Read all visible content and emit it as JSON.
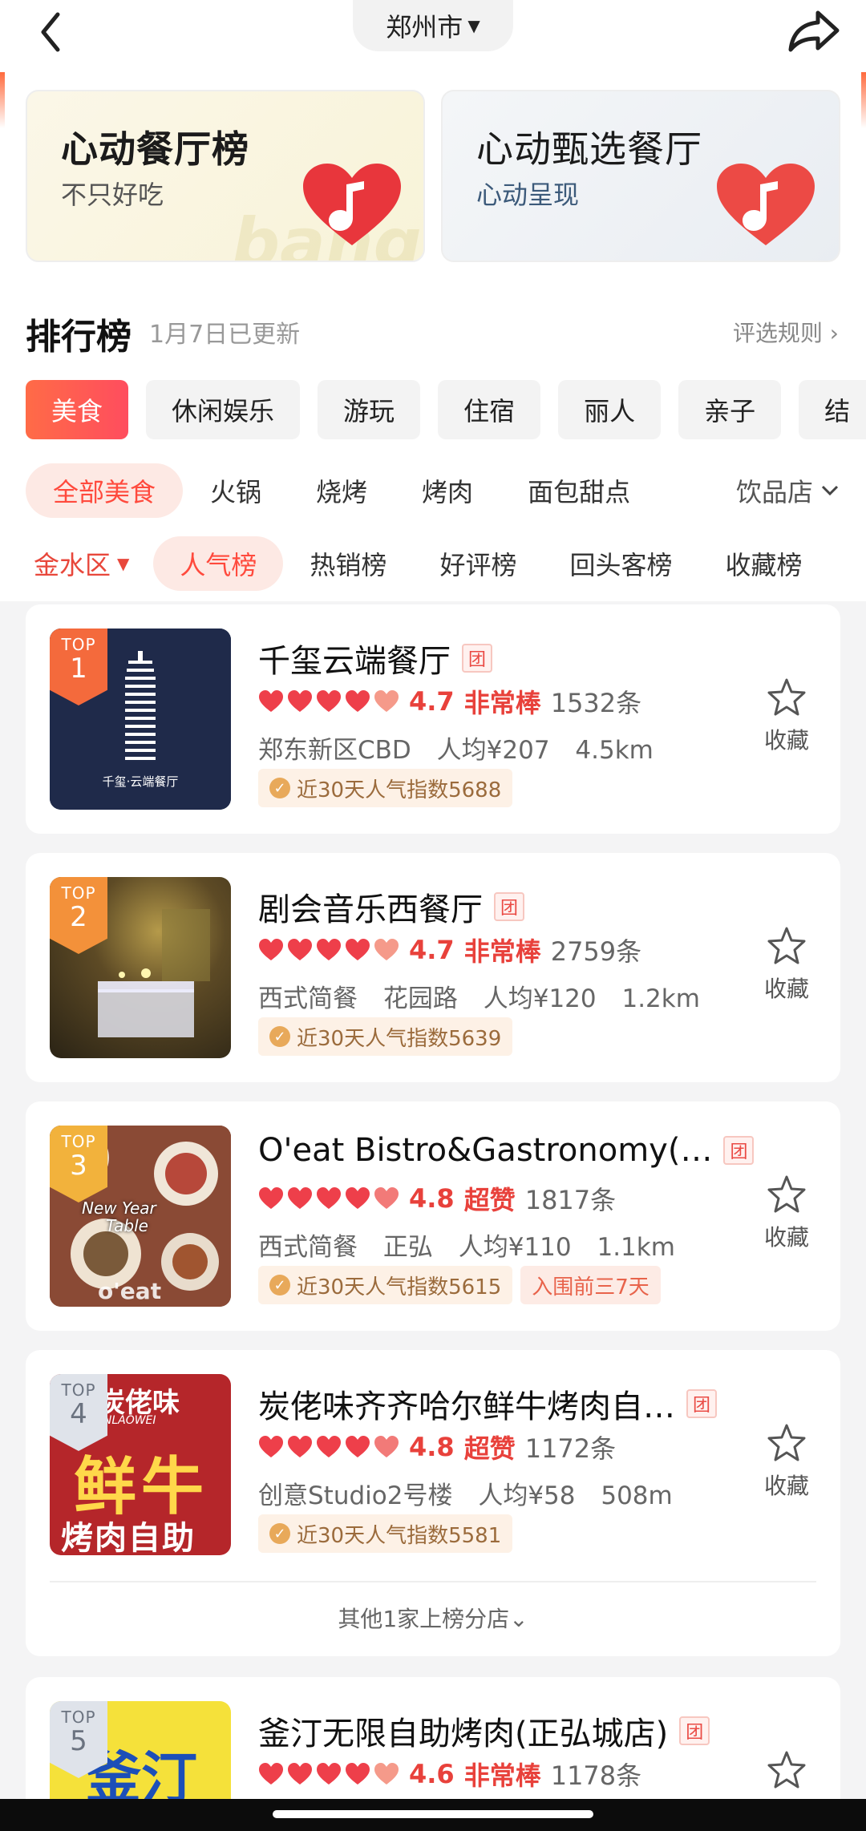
{
  "nav": {
    "city": "郑州市"
  },
  "banners": {
    "left": {
      "title": "心动餐厅榜",
      "subtitle": "不只好吃"
    },
    "right": {
      "title": "心动甄选餐厅",
      "subtitle": "心动呈现"
    }
  },
  "ranking": {
    "title": "排行榜",
    "updated": "1月7日已更新",
    "rules": "评选规则 ›"
  },
  "categories": [
    "美食",
    "休闲娱乐",
    "游玩",
    "住宿",
    "丽人",
    "亲子",
    "结"
  ],
  "subcategories": [
    "全部美食",
    "火锅",
    "烧烤",
    "烤肉",
    "面包甜点"
  ],
  "subcategory_more": "饮品店",
  "district": "金水区",
  "list_tabs": [
    "人气榜",
    "热销榜",
    "好评榜",
    "回头客榜",
    "收藏榜"
  ],
  "tuan_label": "团",
  "fav_label": "收藏",
  "items": [
    {
      "rank_label": "TOP",
      "rank": "1",
      "name": "千玺云端餐厅",
      "score": "4.7",
      "score_label": "非常棒",
      "reviews": "1532条",
      "meta": [
        "郑东新区CBD",
        "人均¥207",
        "4.5km"
      ],
      "tag": "近30天人气指数5688"
    },
    {
      "rank_label": "TOP",
      "rank": "2",
      "name": "剧会音乐西餐厅",
      "score": "4.7",
      "score_label": "非常棒",
      "reviews": "2759条",
      "meta": [
        "西式简餐",
        "花园路",
        "人均¥120",
        "1.2km"
      ],
      "tag": "近30天人气指数5639"
    },
    {
      "rank_label": "TOP",
      "rank": "3",
      "name": "O'eat Bistro&Gastronomy(…",
      "score": "4.8",
      "score_label": "超赞",
      "reviews": "1817条",
      "meta": [
        "西式简餐",
        "正弘",
        "人均¥110",
        "1.1km"
      ],
      "tag": "近30天人气指数5615",
      "tag2": "入围前三7天"
    },
    {
      "rank_label": "TOP",
      "rank": "4",
      "name": "炭佬味齐齐哈尔鲜牛烤肉自…",
      "score": "4.8",
      "score_label": "超赞",
      "reviews": "1172条",
      "meta": [
        "创意Studio2号楼",
        "人均¥58",
        "508m"
      ],
      "tag": "近30天人气指数5581",
      "more_branches": "其他1家上榜分店⌄"
    },
    {
      "rank_label": "TOP",
      "rank": "5",
      "name": "釜汀无限自助烤肉(正弘城店)",
      "score": "4.6",
      "score_label": "非常棒",
      "reviews": "1178条"
    }
  ],
  "thumb_text": {
    "logo1": "千玺·云端餐厅",
    "img3_line1": "New Year",
    "img3_line2": "Table",
    "img3_logo": "o'eat",
    "img4_top": "炭佬味",
    "img4_sub": "TANLAOWEI",
    "img4_main": "鲜牛",
    "img4_bottom": "烤肉自助",
    "img5_text": "釜汀"
  },
  "colors": {
    "accent": "#ff4a3d",
    "score": "#e8413b",
    "active_tab_gradient_start": "#ff6b47",
    "active_tab_gradient_end": "#ff4d5e"
  }
}
